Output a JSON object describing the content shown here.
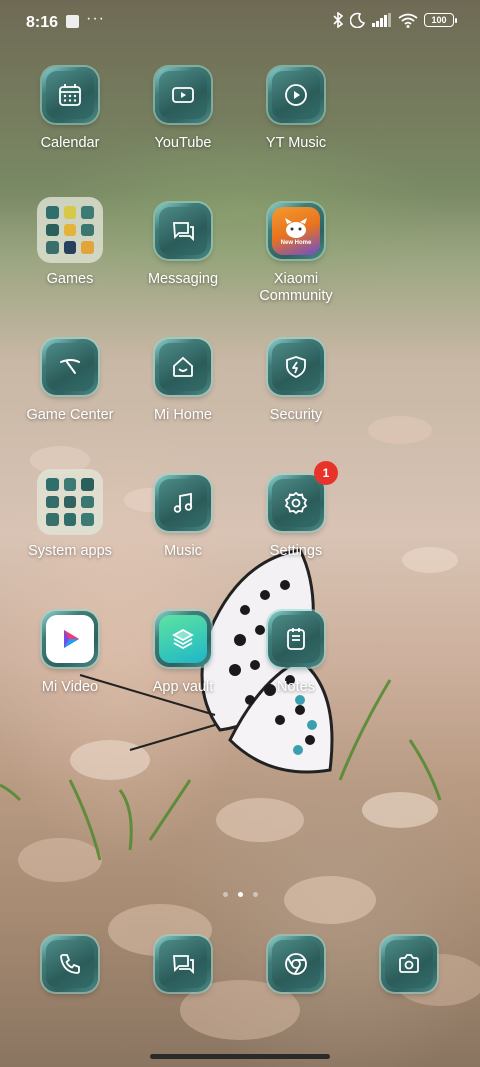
{
  "status": {
    "time": "8:16",
    "dots": "···",
    "battery": "100"
  },
  "apps": {
    "calendar": "Calendar",
    "youtube": "YouTube",
    "ytmusic": "YT Music",
    "games": "Games",
    "messaging": "Messaging",
    "xiaomi_community": "Xiaomi Community",
    "xiaomi_community_badge": "New Home",
    "game_center": "Game Center",
    "mi_home": "Mi Home",
    "security": "Security",
    "system_apps": "System apps",
    "music": "Music",
    "settings": "Settings",
    "settings_badge": "1",
    "mi_video": "Mi Video",
    "app_vault": "App vault",
    "notes": "Notes"
  },
  "colors": {
    "icon_teal": "#2f6260",
    "badge_red": "#e8332b"
  }
}
